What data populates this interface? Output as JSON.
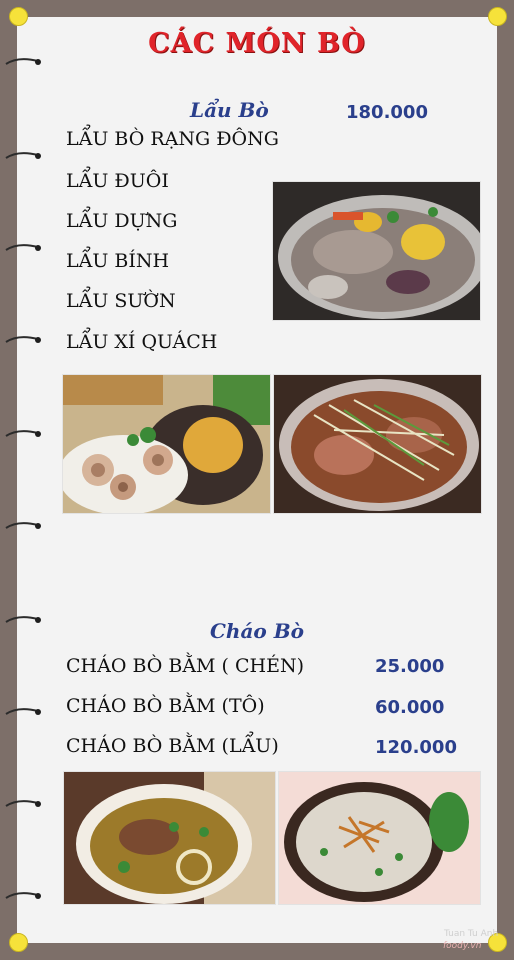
{
  "title": "CÁC MÓN BÒ",
  "lau": {
    "heading": "Lẩu Bò",
    "price": "180.000",
    "items": [
      "LẨU BÒ RẠNG ĐÔNG",
      "LẨU ĐUÔI",
      "LẨU DỰNG",
      "LẨU BÍNH",
      "LẨU SƯỜN",
      "LẨU XÍ QUÁCH"
    ]
  },
  "chao": {
    "heading": "Cháo Bò",
    "items": [
      {
        "name": "CHÁO BÒ BẰM ( CHÉN)",
        "price": "25.000"
      },
      {
        "name": "CHÁO BÒ BẰM (TÔ)",
        "price": "60.000"
      },
      {
        "name": "CHÁO BÒ BẰM (LẨU)",
        "price": "120.000"
      }
    ]
  },
  "watermark": {
    "author": "Tuan Tu Anh",
    "brand": "foody.vn"
  },
  "colors": {
    "title": "#e0242a",
    "heading": "#2a3f8c",
    "corner": "#f6e23a",
    "background": "#7d6f69"
  }
}
